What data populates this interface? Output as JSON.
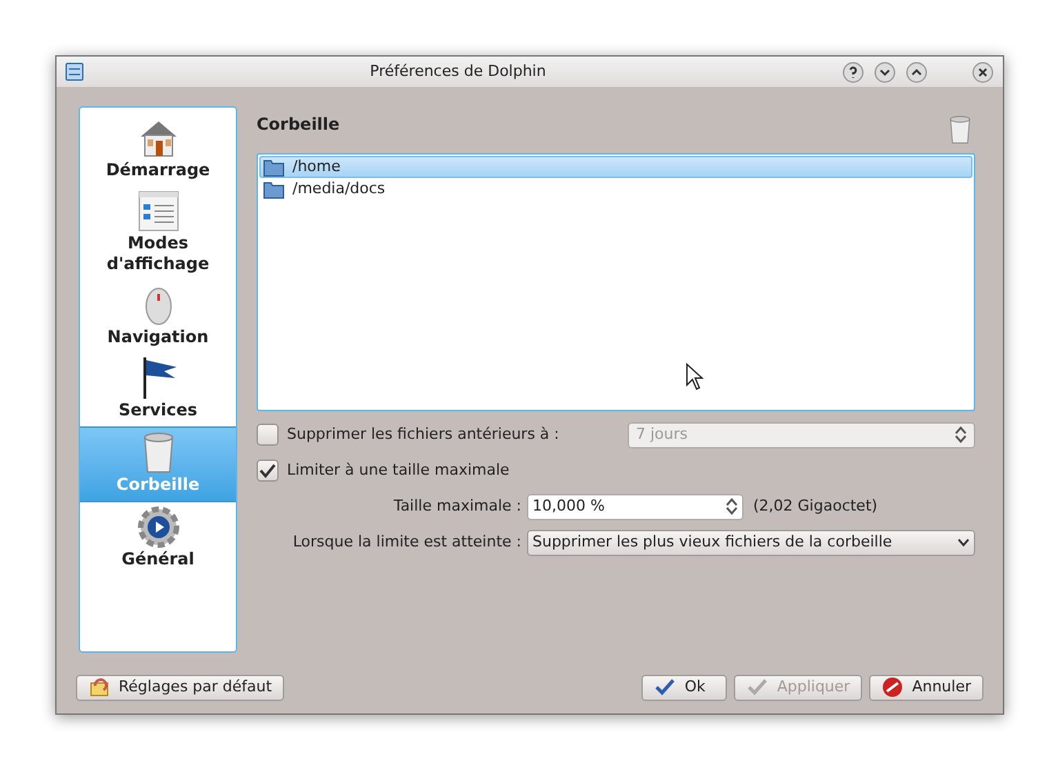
{
  "window": {
    "title": "Préférences de Dolphin"
  },
  "sidebar": {
    "items": [
      {
        "label": "Démarrage",
        "kind": "house",
        "selected": false
      },
      {
        "label": "Modes d'affichage",
        "kind": "views",
        "selected": false
      },
      {
        "label": "Navigation",
        "kind": "mouse",
        "selected": false
      },
      {
        "label": "Services",
        "kind": "flag",
        "selected": false
      },
      {
        "label": "Corbeille",
        "kind": "trash",
        "selected": true
      },
      {
        "label": "Général",
        "kind": "gear",
        "selected": false
      }
    ]
  },
  "page": {
    "title": "Corbeille",
    "folders": [
      {
        "path": "/home",
        "selected": true
      },
      {
        "path": "/media/docs",
        "selected": false
      }
    ],
    "age_limit": {
      "label": "Supprimer les fichiers antérieurs à :",
      "checked": false,
      "value": "7 jours"
    },
    "size_limit": {
      "label": "Limiter à une taille maximale",
      "checked": true
    },
    "max_size": {
      "label": "Taille maximale :",
      "value": "10,000 %",
      "note": "(2,02 Gigaoctet)"
    },
    "on_limit": {
      "label": "Lorsque la limite est atteinte :",
      "value": "Supprimer les plus vieux fichiers de la corbeille"
    }
  },
  "buttons": [
    {
      "label": "Réglages par défaut",
      "kind": "defaults",
      "disabled": false
    },
    {
      "label": "Ok",
      "kind": "ok",
      "disabled": false
    },
    {
      "label": "Appliquer",
      "kind": "apply",
      "disabled": true
    },
    {
      "label": "Annuler",
      "kind": "cancel",
      "disabled": false
    }
  ]
}
